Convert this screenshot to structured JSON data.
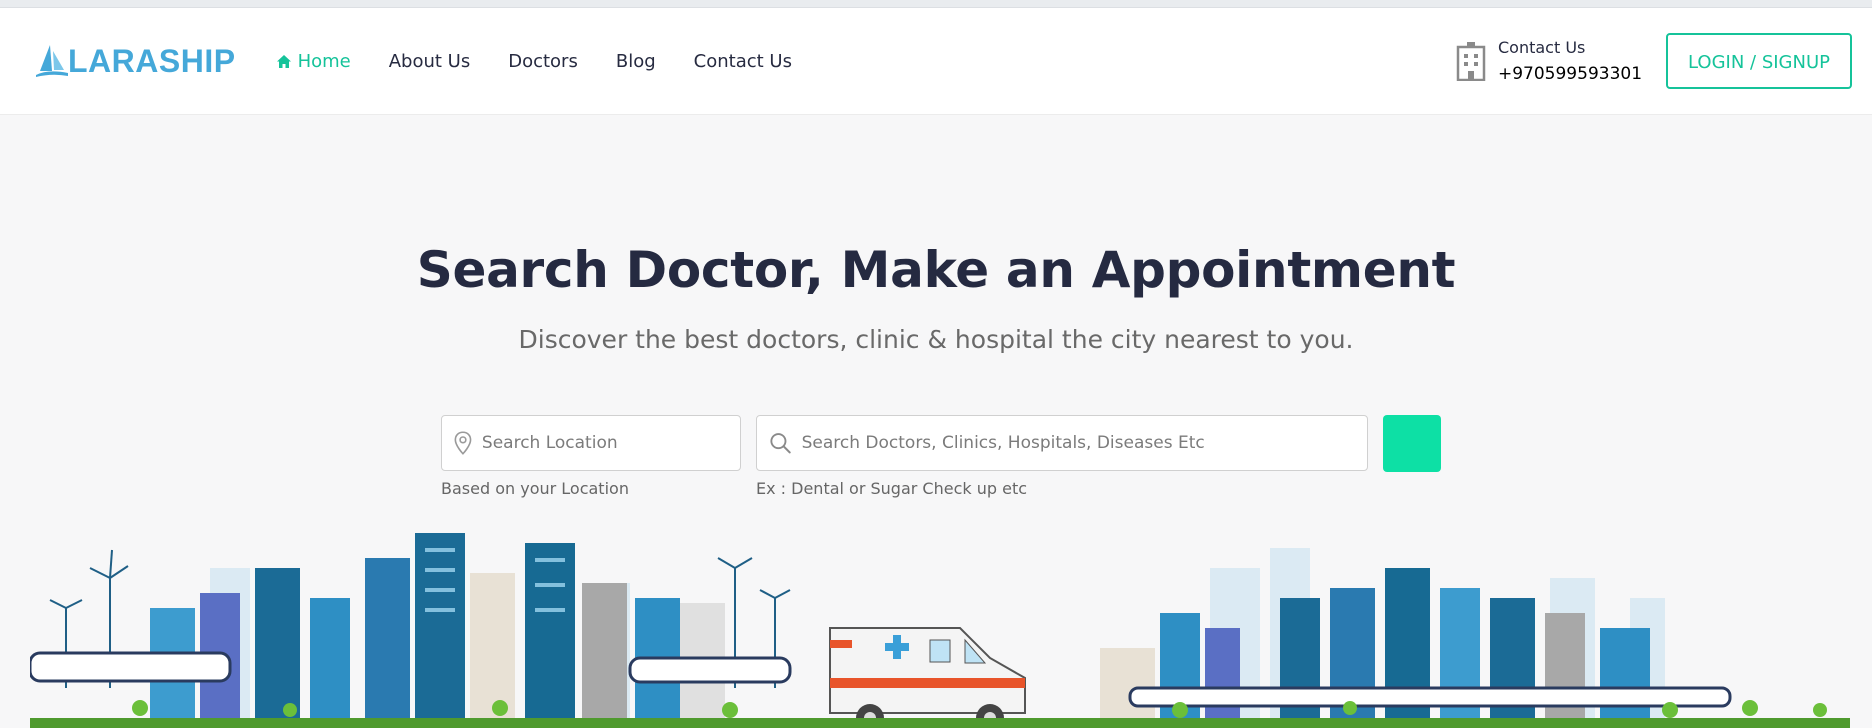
{
  "brand": {
    "logo_text": "LARASHIP"
  },
  "nav": {
    "items": [
      {
        "label": "Home",
        "active": true
      },
      {
        "label": "About Us"
      },
      {
        "label": "Doctors"
      },
      {
        "label": "Blog"
      },
      {
        "label": "Contact Us"
      }
    ]
  },
  "header_contact": {
    "label": "Contact Us",
    "phone": "+970599593301"
  },
  "login_label": "LOGIN / SIGNUP",
  "hero": {
    "title": "Search Doctor, Make an Appointment",
    "subtitle": "Discover the best doctors, clinic & hospital the city nearest to you."
  },
  "search": {
    "location_placeholder": "Search Location",
    "location_hint": "Based on your Location",
    "keyword_placeholder": "Search Doctors, Clinics, Hospitals, Diseases Etc",
    "keyword_hint": "Ex : Dental or Sugar Check up etc"
  },
  "colors": {
    "accent": "#15c39a",
    "button": "#0de0a5",
    "brand": "#45a8d9",
    "title": "#252a41"
  },
  "icons": [
    "home-icon",
    "hospital-building-icon",
    "map-pin-icon",
    "search-icon",
    "logo-sail-icon"
  ]
}
